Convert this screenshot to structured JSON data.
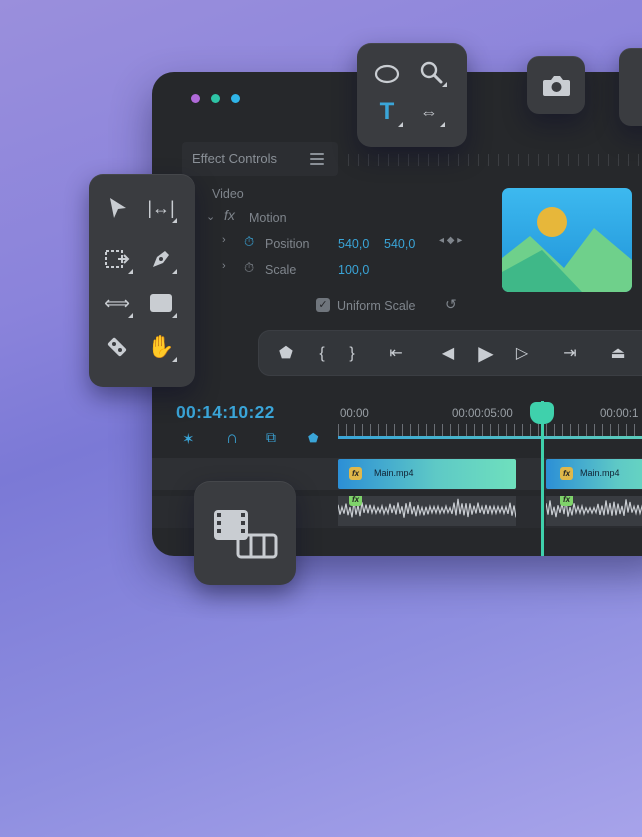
{
  "window": {
    "dots": [
      "#b06ad9",
      "#2ec4a6",
      "#2fb5e8"
    ]
  },
  "effect_controls": {
    "title": "Effect Controls",
    "menu_icon": "hamburger-menu-icon",
    "section_label": "Video",
    "motion_label": "Motion",
    "fx_label": "fx",
    "properties": [
      {
        "name": "Position",
        "values": [
          "540,0",
          "540,0"
        ]
      },
      {
        "name": "Scale",
        "values": [
          "100,0"
        ]
      }
    ],
    "uniform_scale_label": "Uniform Scale",
    "uniform_scale_checked": true
  },
  "timeline": {
    "timecode": "00:14:10:22",
    "ruler_labels": [
      "00:00",
      "00:00:05:00",
      "00:00:1"
    ],
    "clips": [
      {
        "name": "Main.mp4",
        "fx": "fx"
      },
      {
        "name": "Main.mp4",
        "fx": "fx"
      }
    ],
    "audio_fx": [
      "fx",
      "fx"
    ]
  },
  "tools_palette": {
    "items": [
      "selection-arrow-icon",
      "ripple-edit-icon",
      "track-select-icon",
      "pen-icon",
      "slip-icon",
      "rectangle-icon",
      "razor-icon",
      "hand-icon"
    ]
  },
  "top_palette": {
    "items": [
      "ellipse-icon",
      "zoom-icon",
      "type-icon",
      "rate-stretch-icon"
    ]
  },
  "transport": {
    "items": [
      "marker-icon",
      "mark-in-icon",
      "mark-out-icon",
      "go-to-in-icon",
      "step-back-icon",
      "play-icon",
      "step-forward-icon",
      "go-to-out-icon",
      "lift-icon"
    ]
  },
  "colors": {
    "accent_blue": "#3aa5d8",
    "accent_teal": "#3fd1ac",
    "panel": "#26282b",
    "clip_label": "#e0b84a",
    "audio_label": "#7fd36a"
  }
}
